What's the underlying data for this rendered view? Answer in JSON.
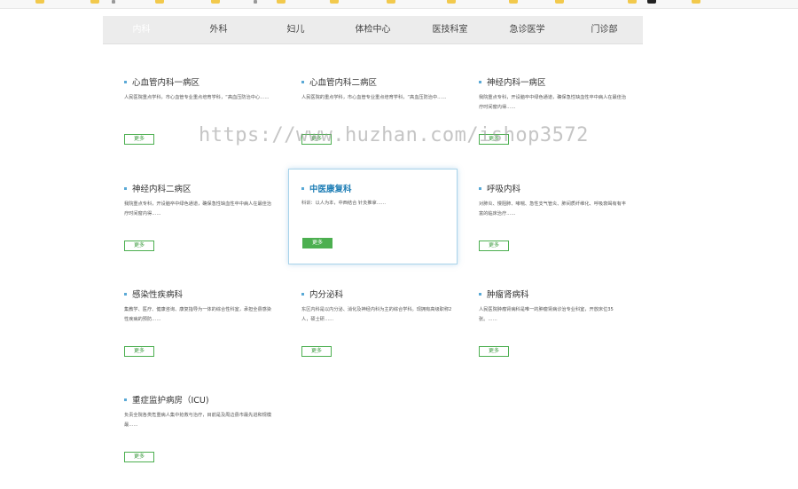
{
  "nav": {
    "items": [
      {
        "label": "内科"
      },
      {
        "label": "外科"
      },
      {
        "label": "妇儿"
      },
      {
        "label": "体检中心"
      },
      {
        "label": "医技科室"
      },
      {
        "label": "急诊医学"
      },
      {
        "label": "门诊部"
      }
    ]
  },
  "departments": [
    {
      "title": "心血管内科一病区",
      "desc": "人民医院重点学科，市心血管专业重点培育学科，“高血压防治中心……",
      "more": "更多"
    },
    {
      "title": "心血管内科二病区",
      "desc": "人民医院的重点学科，市心血管专业重点培育学科，“高血压防治中……",
      "more": "更多"
    },
    {
      "title": "神经内科一病区",
      "desc": "我院重点专科，开设脑卒中绿色通道，确保急性缺血性卒中病人在最佳治疗时间窗内得……",
      "more": "更多"
    },
    {
      "title": "神经内科二病区",
      "desc": "我院重点专科，开设脑卒中绿色通道，确保急性缺血性卒中病人在最佳治疗时间窗内得……",
      "more": "更多"
    },
    {
      "title": "中医康复科",
      "desc": "科训：以人为本，中西结合 针灸推拿……",
      "more": "更多"
    },
    {
      "title": "呼吸内科",
      "desc": "对肺炎、慢阻肺、哮喘、急性支气管炎、肺间质纤维化、呼吸衰竭有有丰富的临床治疗……",
      "more": "更多"
    },
    {
      "title": "感染性疾病科",
      "desc": "集教学、医疗、健康咨询、康复指导为一体的综合性科室，承担全县感染性疾病的预防……",
      "more": "更多"
    },
    {
      "title": "内分泌科",
      "desc": "东区内科是以内分泌、消化及神经内科为主的综合学科。现拥有高级职称2人，硕士研……",
      "more": "更多"
    },
    {
      "title": "肿瘤肾病科",
      "desc": "人民医院肿瘤肾病科是唯一的肿瘤肾病诊治专业科室，开放床位35张。……",
      "more": "更多"
    },
    {
      "title": "重症监护病房（ICU)",
      "desc": "负责全院各类危重病人集中抢救与治疗，目前是及周边县市最先进和规模最……",
      "more": "更多"
    }
  ],
  "watermark": "https://www.huzhan.com/ishop3572",
  "colors": {
    "accent_green": "#4caf50",
    "title_blue": "#1d7db5",
    "nav_bg": "#ececec",
    "highlight_border": "#a9d3ea"
  }
}
